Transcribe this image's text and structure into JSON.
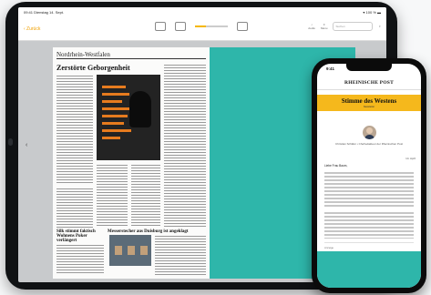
{
  "tablet": {
    "status_time": "09:41  Dienstag 14. Sept.",
    "status_battery": "▾ 100 % ▬",
    "toolbar": {
      "back_label": "‹ Zurück",
      "search_placeholder": "Suchen",
      "right_labels": [
        "Audio",
        "Menu"
      ],
      "slider_value": 0.33
    },
    "newspaper": {
      "region": "Nordrhein-Westfalen",
      "headline": "Zerstörte Geborgenheit",
      "lower_headline_left": "Silk stimmt faktisch Wohnens Poker verlängert",
      "lower_headline_right": "Messerstecher aus Duisburg ist angeklagt"
    }
  },
  "phone": {
    "time": "9:41",
    "brand": "RHEINISCHE POST",
    "banner_title": "Stimme des Westens",
    "banner_sub": "Newsletter",
    "author": "Christian Schäfer • Chefredakteur der Rheinischen Post",
    "date": "14. April",
    "greeting": "Liebe Frau Baum,",
    "ad_label": "Anzeige"
  },
  "colors": {
    "accent_yellow": "#f5b81c",
    "teal": "#2eb6aa",
    "orange": "#e67b1e"
  }
}
